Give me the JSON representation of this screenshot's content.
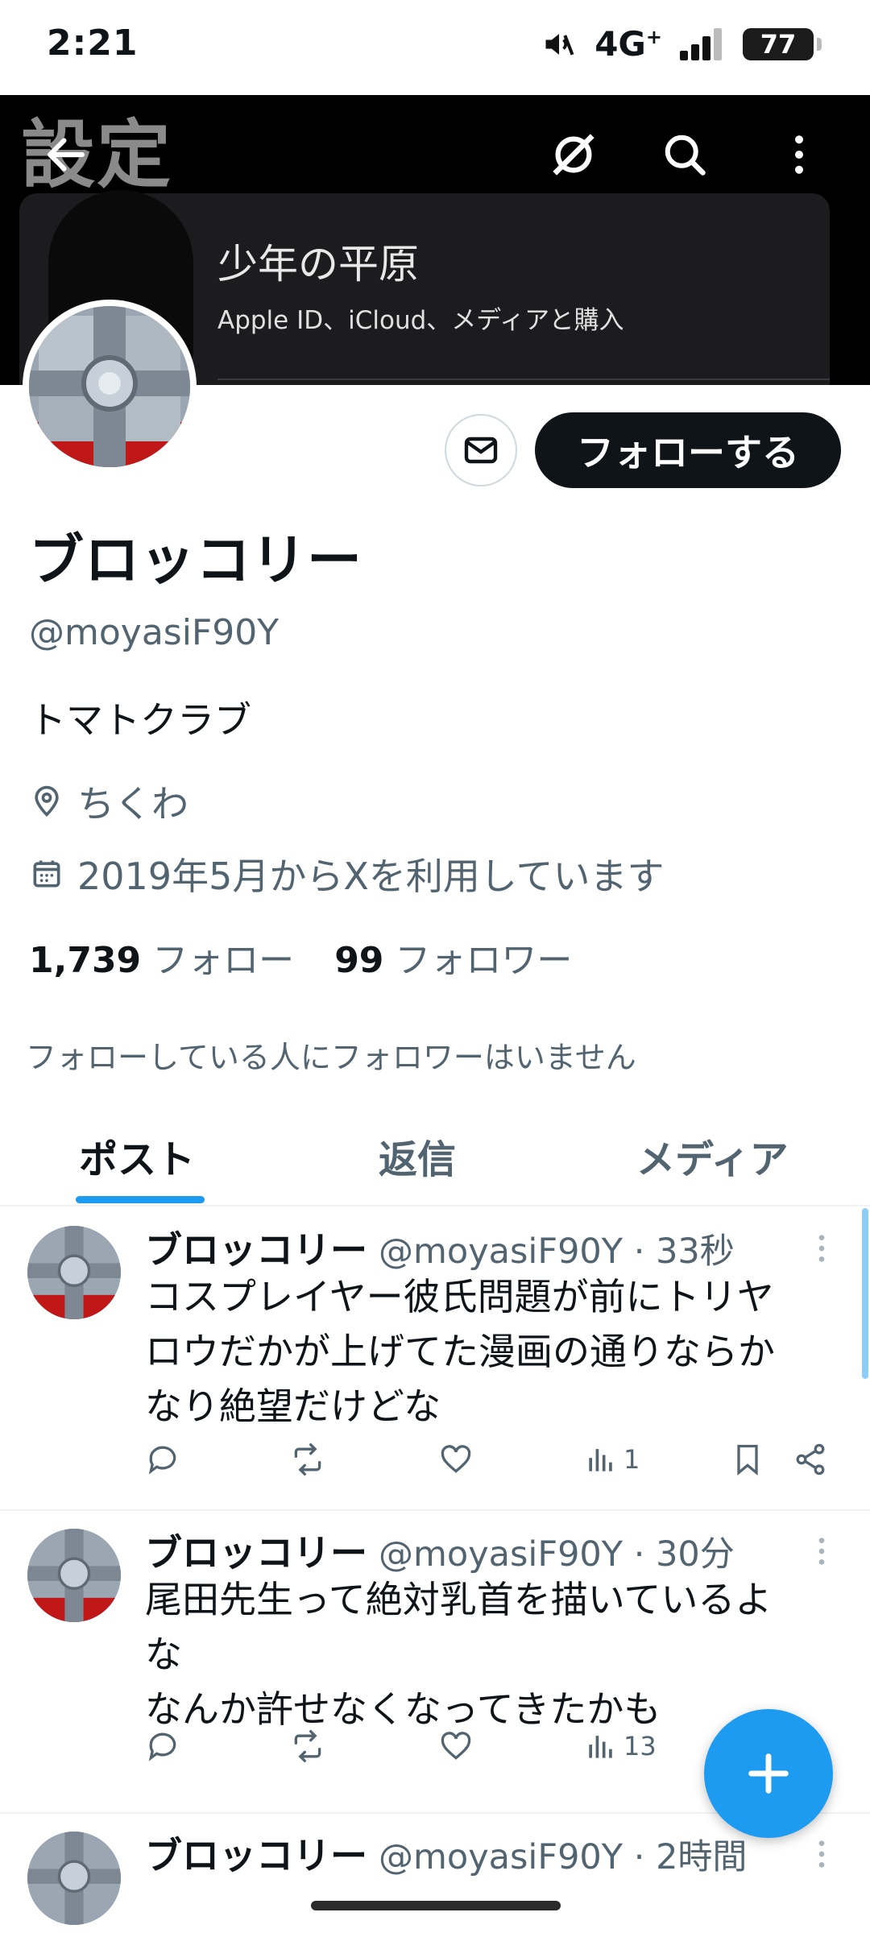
{
  "status_bar": {
    "time": "2:21",
    "network": "4G",
    "network_sup": "+",
    "battery": "77"
  },
  "banner": {
    "watermark": "設定",
    "card_name": "少年の平原",
    "card_sub": "Apple ID、iCloud、メディアと購入"
  },
  "profile": {
    "display_name": "ブロッコリー",
    "handle": "@moyasiF90Y",
    "bio": "トマトクラブ",
    "location": "ちくわ",
    "joined": "2019年5月からXを利用しています",
    "following_count": "1,739",
    "following_label": "フォロー",
    "followers_count": "99",
    "followers_label": "フォロワー",
    "mutuals_note": "フォローしている人にフォロワーはいません",
    "follow_button": "フォローする"
  },
  "tabs": [
    {
      "label": "ポスト",
      "active": true
    },
    {
      "label": "返信",
      "active": false
    },
    {
      "label": "メディア",
      "active": false
    }
  ],
  "posts": [
    {
      "name": "ブロッコリー",
      "meta": "@moyasiF90Y · 33秒",
      "text": "コスプレイヤー彼氏問題が前にトリヤ\nロウだかが上げてた漫画の通りならか\nなり絶望だけどな",
      "views": "1"
    },
    {
      "name": "ブロッコリー",
      "meta": "@moyasiF90Y · 30分",
      "text": "尾田先生って絶対乳首を描いているよ\nな\nなんか許せなくなってきたかも",
      "views": "13"
    },
    {
      "name": "ブロッコリー",
      "meta": "@moyasiF90Y · 2時間",
      "text": "",
      "views": ""
    }
  ],
  "colors": {
    "accent": "#1d9bf0",
    "text_primary": "#0f1419",
    "text_secondary": "#536471"
  },
  "icons": [
    "back-arrow-icon",
    "grok-icon",
    "search-icon",
    "more-vertical-icon",
    "mail-icon",
    "location-pin-icon",
    "calendar-icon",
    "reply-icon",
    "repost-icon",
    "like-icon",
    "views-icon",
    "bookmark-icon",
    "share-icon",
    "plus-icon"
  ]
}
